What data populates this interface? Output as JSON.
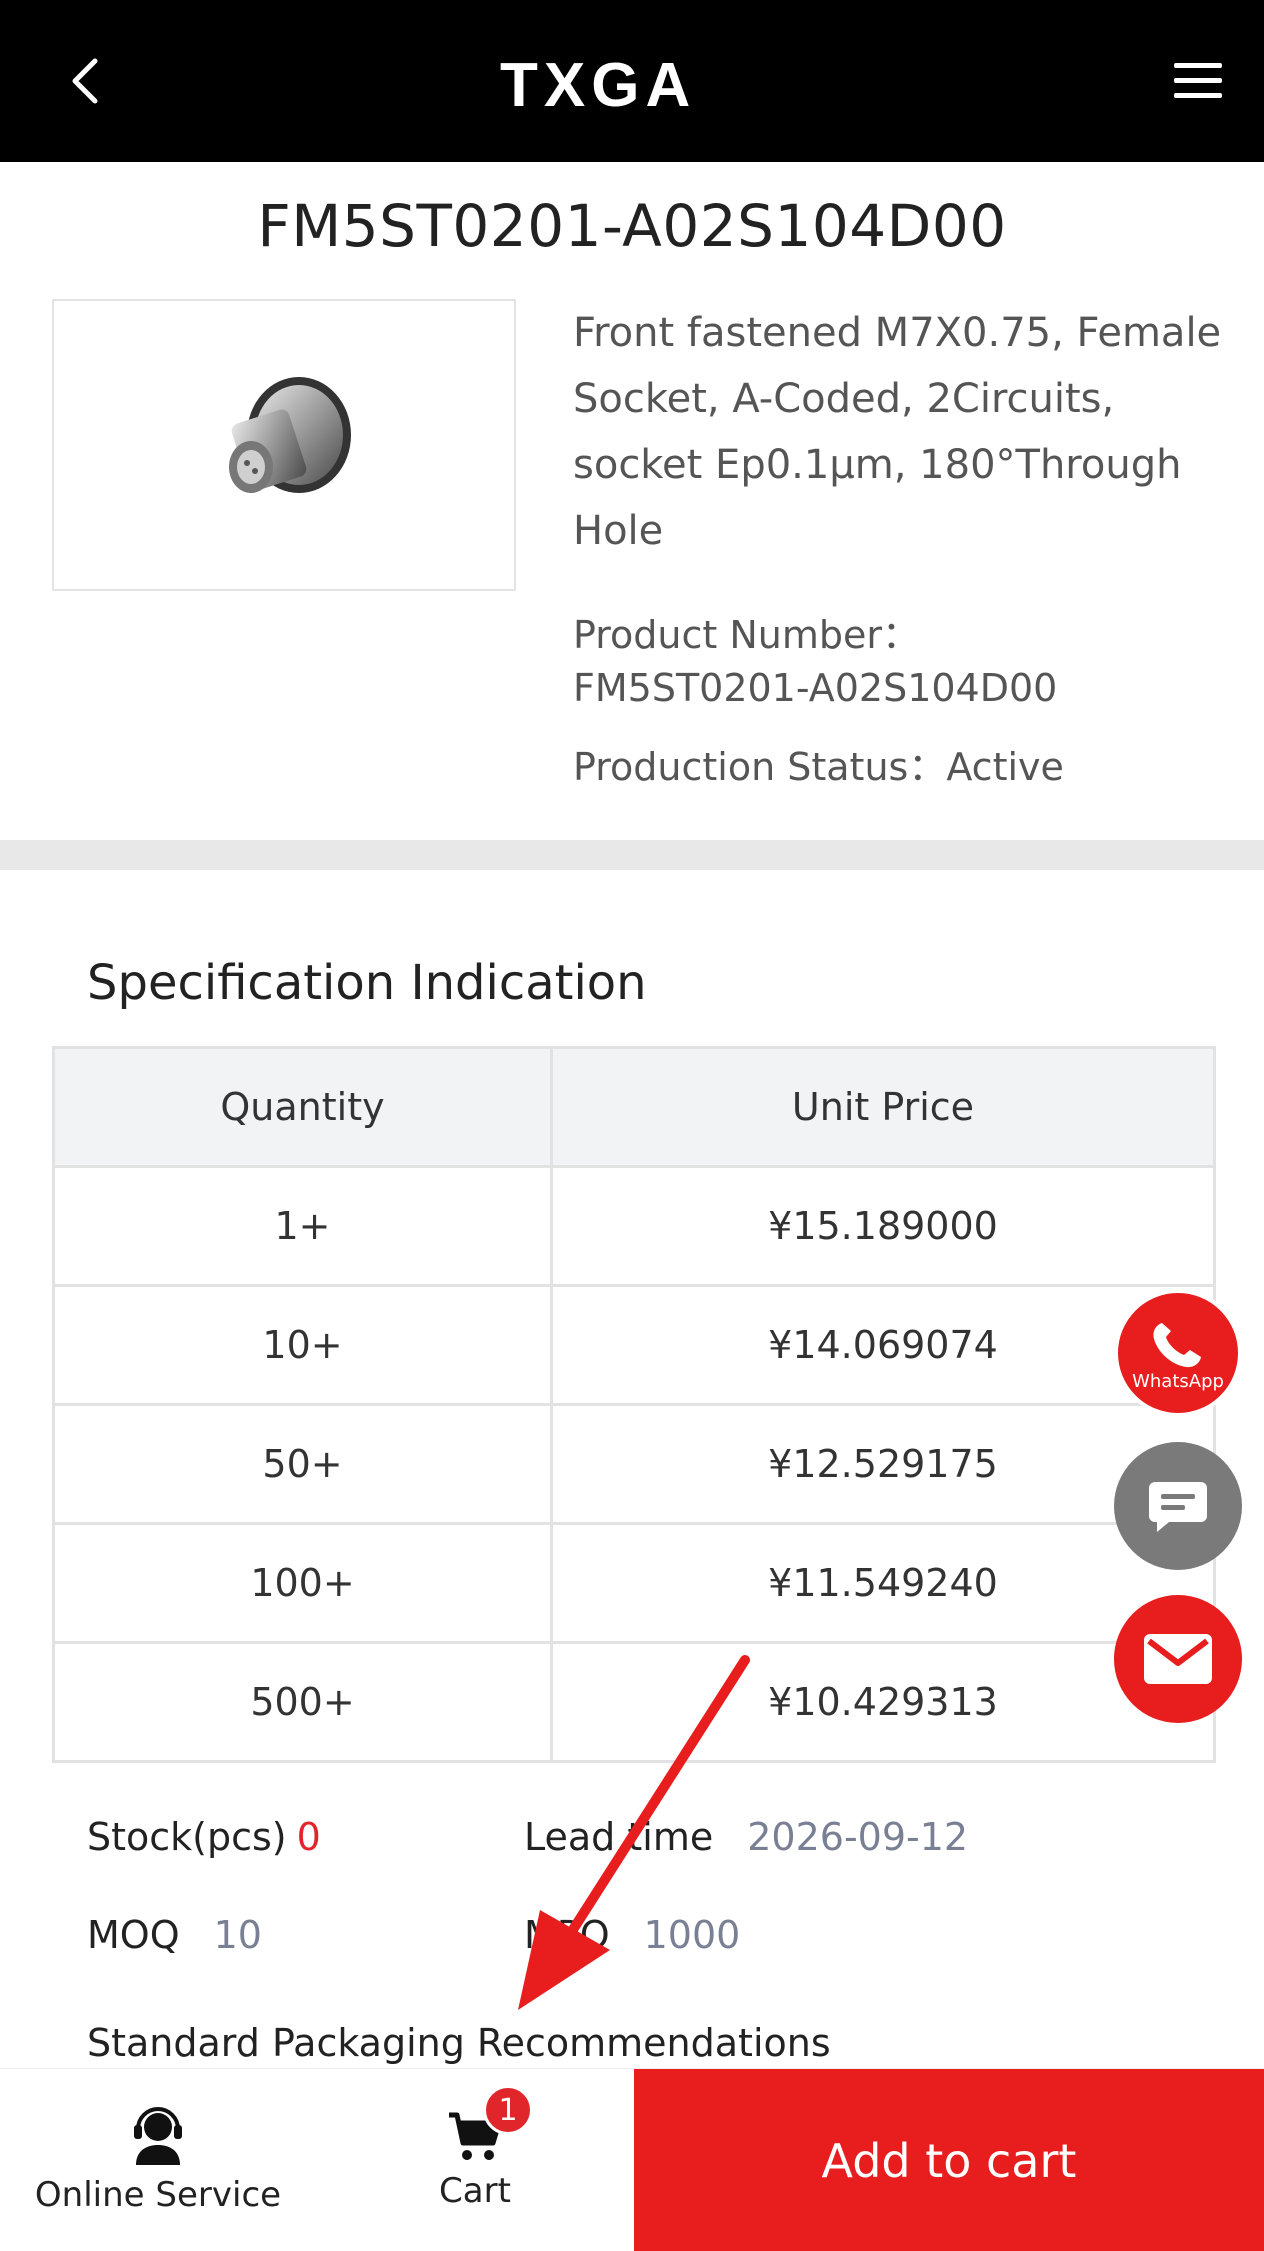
{
  "header": {
    "logo_text": "TXGA",
    "back_icon": "chevron-left-icon",
    "menu_icon": "hamburger-menu-icon"
  },
  "product": {
    "title": "FM5ST0201-A02S104D00",
    "description": "Front fastened M7X0.75, Female Socket, A-Coded, 2Circuits, socket Ep0.1μm, 180°Through Hole",
    "product_number_label": "Product Number：",
    "product_number": "FM5ST0201-A02S104D00",
    "status_label": "Production Status：",
    "status_value": "Active"
  },
  "spec": {
    "title": "Specification Indication",
    "columns": [
      "Quantity",
      "Unit Price"
    ],
    "rows": [
      [
        "1+",
        "¥15.189000"
      ],
      [
        "10+",
        "¥14.069074"
      ],
      [
        "50+",
        "¥12.529175"
      ],
      [
        "100+",
        "¥11.549240"
      ],
      [
        "500+",
        "¥10.429313"
      ]
    ]
  },
  "stock": {
    "stock_label": "Stock(pcs)",
    "stock_value": "0",
    "lead_label": "Lead time",
    "lead_value": "2026-09-12",
    "moq_label": "MOQ",
    "moq_value": "10",
    "mpq_label": "MPQ",
    "mpq_value": "1000",
    "packaging_label": "Standard Packaging Recommendations"
  },
  "floating": {
    "whatsapp_label": "WhatsApp",
    "whatsapp_color": "#e81d1d",
    "chat_color": "#7a7a7a",
    "mail_color": "#e81d1d"
  },
  "bottom_bar": {
    "service_label": "Online Service",
    "cart_label": "Cart",
    "cart_count": "1",
    "add_to_cart_label": "Add to cart",
    "accent": "#e81d1d"
  }
}
